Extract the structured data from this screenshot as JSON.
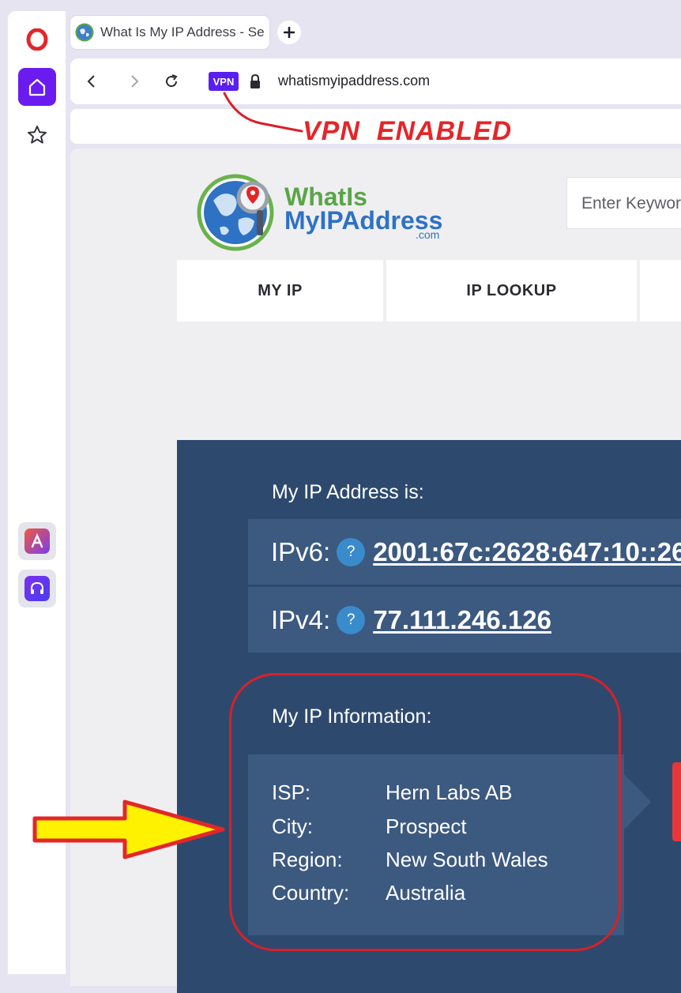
{
  "browser": {
    "tab_title": "What Is My IP Address - Se",
    "url": "whatismyipaddress.com",
    "vpn_badge": "VPN"
  },
  "annotation": {
    "vpn_note": "VPN  ENABLED"
  },
  "site": {
    "logo_line1": "WhatIs",
    "logo_line2": "MyIPAddress",
    "logo_line3": ".com",
    "search_placeholder": "Enter Keywor",
    "nav": [
      "MY IP",
      "IP LOOKUP"
    ]
  },
  "ip": {
    "heading": "My IP Address is:",
    "ipv6_label": "IPv6:",
    "ipv6_value": "2001:67c:2628:647:10::26",
    "ipv4_label": "IPv4:",
    "ipv4_value": "77.111.246.126",
    "help_glyph": "?"
  },
  "info": {
    "heading": "My IP Information:",
    "rows": [
      {
        "label": "ISP:",
        "value": "Hern Labs AB"
      },
      {
        "label": "City:",
        "value": "Prospect"
      },
      {
        "label": "Region:",
        "value": "New South Wales"
      },
      {
        "label": "Country:",
        "value": "Australia"
      }
    ]
  },
  "colors": {
    "opera_red": "#e3262a",
    "opera_purple": "#6a1cf0",
    "panel_bg": "#2d4a6e",
    "row_bg": "#3c5980",
    "annotation_red": "#d8202a",
    "arrow_yellow": "#fff200"
  },
  "icons": [
    "opera-logo-icon",
    "home-icon",
    "star-icon",
    "aria-icon",
    "headphones-icon",
    "globe-favicon-icon",
    "plus-icon",
    "back-icon",
    "forward-icon",
    "reload-icon",
    "lock-icon"
  ]
}
